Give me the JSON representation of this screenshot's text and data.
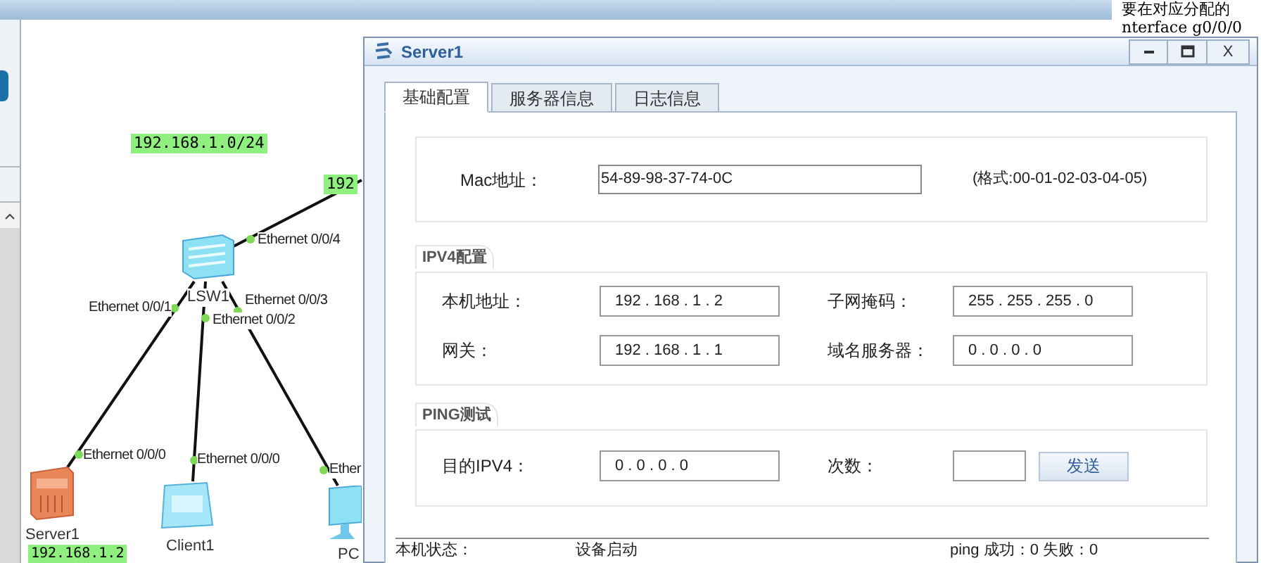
{
  "top_note": {
    "line_1": "要在对应分配的",
    "line_2": "nterface g0/0/0"
  },
  "topology": {
    "subnet_labels": [
      "192.168.1.0/24",
      "192",
      "192.168.1.2"
    ],
    "devices": [
      {
        "kind": "switch",
        "name": "LSW1"
      },
      {
        "kind": "server",
        "name": "Server1"
      },
      {
        "kind": "client",
        "name": "Client1"
      },
      {
        "kind": "pc",
        "name": "PC"
      }
    ],
    "port_labels": [
      "Ethernet 0/0/4",
      "Ethernet 0/0/1",
      "Ethernet 0/0/3",
      "Ethernet 0/0/2",
      "Ethernet 0/0/0",
      "Ethernet 0/0/0",
      "Ether"
    ]
  },
  "dialog": {
    "title": "Server1",
    "close": "X",
    "tabs": [
      {
        "label": "基础配置",
        "selected": true
      },
      {
        "label": "服务器信息",
        "selected": false
      },
      {
        "label": "日志信息",
        "selected": false
      }
    ],
    "mac": {
      "label": "Mac地址：",
      "value": "54-89-98-37-74-0C",
      "hint": "(格式:00-01-02-03-04-05)"
    },
    "ipv4": {
      "title": "IPV4配置",
      "fields": [
        {
          "label": "本机地址：",
          "value": "192 . 168 . 1 . 2"
        },
        {
          "label": "子网掩码：",
          "value": "255 . 255 . 255 . 0"
        },
        {
          "label": "网关：",
          "value": "192 . 168 . 1 . 1"
        },
        {
          "label": "域名服务器：",
          "value": "0 . 0 . 0 . 0"
        }
      ]
    },
    "ping": {
      "title": "PING测试",
      "target": {
        "label": "目的IPV4：",
        "value": "0 . 0 . 0 . 0"
      },
      "count": {
        "label": "次数："
      },
      "send_button": "发送"
    },
    "status": {
      "label": "本机状态：",
      "value": "设备启动",
      "ping_result": "ping 成功：0 失败：0"
    }
  }
}
